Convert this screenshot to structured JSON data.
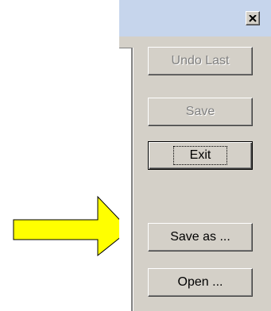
{
  "titlebar": {
    "close_icon": "close-icon"
  },
  "buttons": {
    "undo_last": "Undo Last",
    "save": "Save",
    "exit": "Exit",
    "save_as": "Save as ...",
    "open": "Open ..."
  },
  "colors": {
    "dialog_face": "#d4d0c8",
    "titlebar": "#c6d5ec",
    "arrow_fill": "#ffff00",
    "disabled_text": "#808080"
  },
  "annotation": {
    "arrow_icon": "pointer-arrow-icon"
  }
}
